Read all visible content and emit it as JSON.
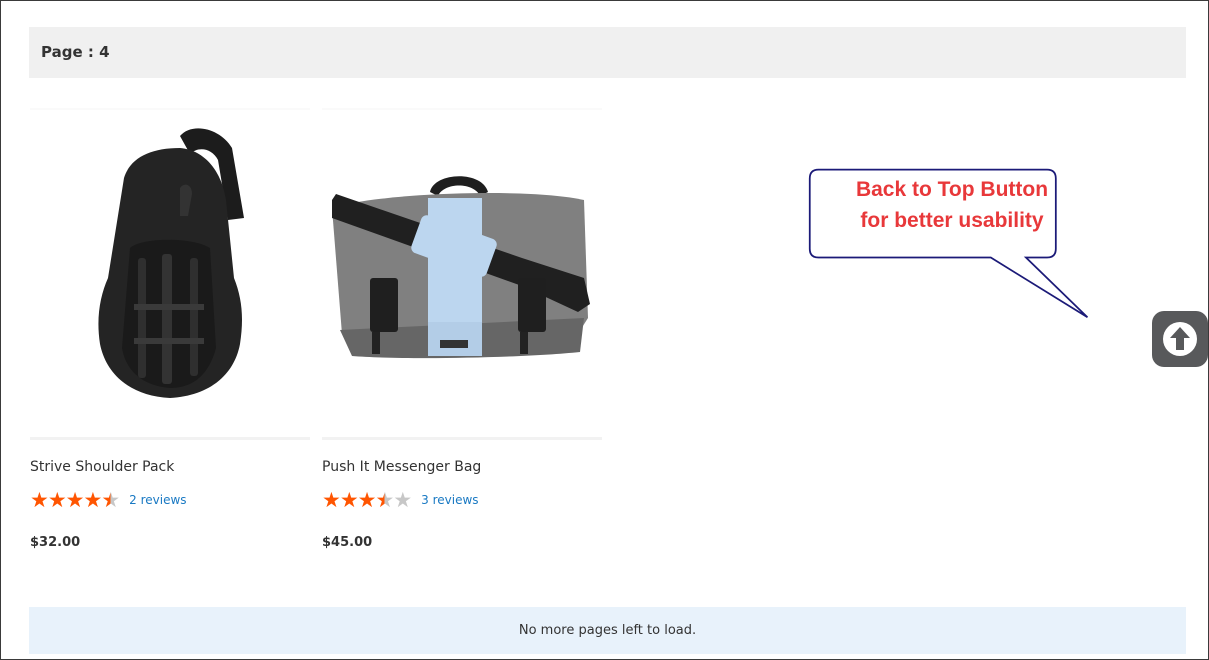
{
  "page_indicator": {
    "label": "Page : 4"
  },
  "products": [
    {
      "name": "Strive Shoulder Pack",
      "rating_stars": 4.5,
      "reviews_label": "2 reviews",
      "price": "$32.00",
      "image_icon": "sling-backpack"
    },
    {
      "name": "Push It Messenger Bag",
      "rating_stars": 3.5,
      "reviews_label": "3 reviews",
      "price": "$45.00",
      "image_icon": "messenger-bag"
    }
  ],
  "end_message": "No more pages left to load.",
  "callout": {
    "line1": "Back to Top Button",
    "line2": "for better usability"
  },
  "back_to_top": {
    "icon": "arrow-up-icon"
  },
  "colors": {
    "star_full": "#ff5501",
    "star_empty": "#c7c7c7",
    "link": "#1979c3",
    "callout_text": "#e8383a",
    "callout_border": "#1b1a78",
    "back_to_top_bg": "#58595b"
  }
}
